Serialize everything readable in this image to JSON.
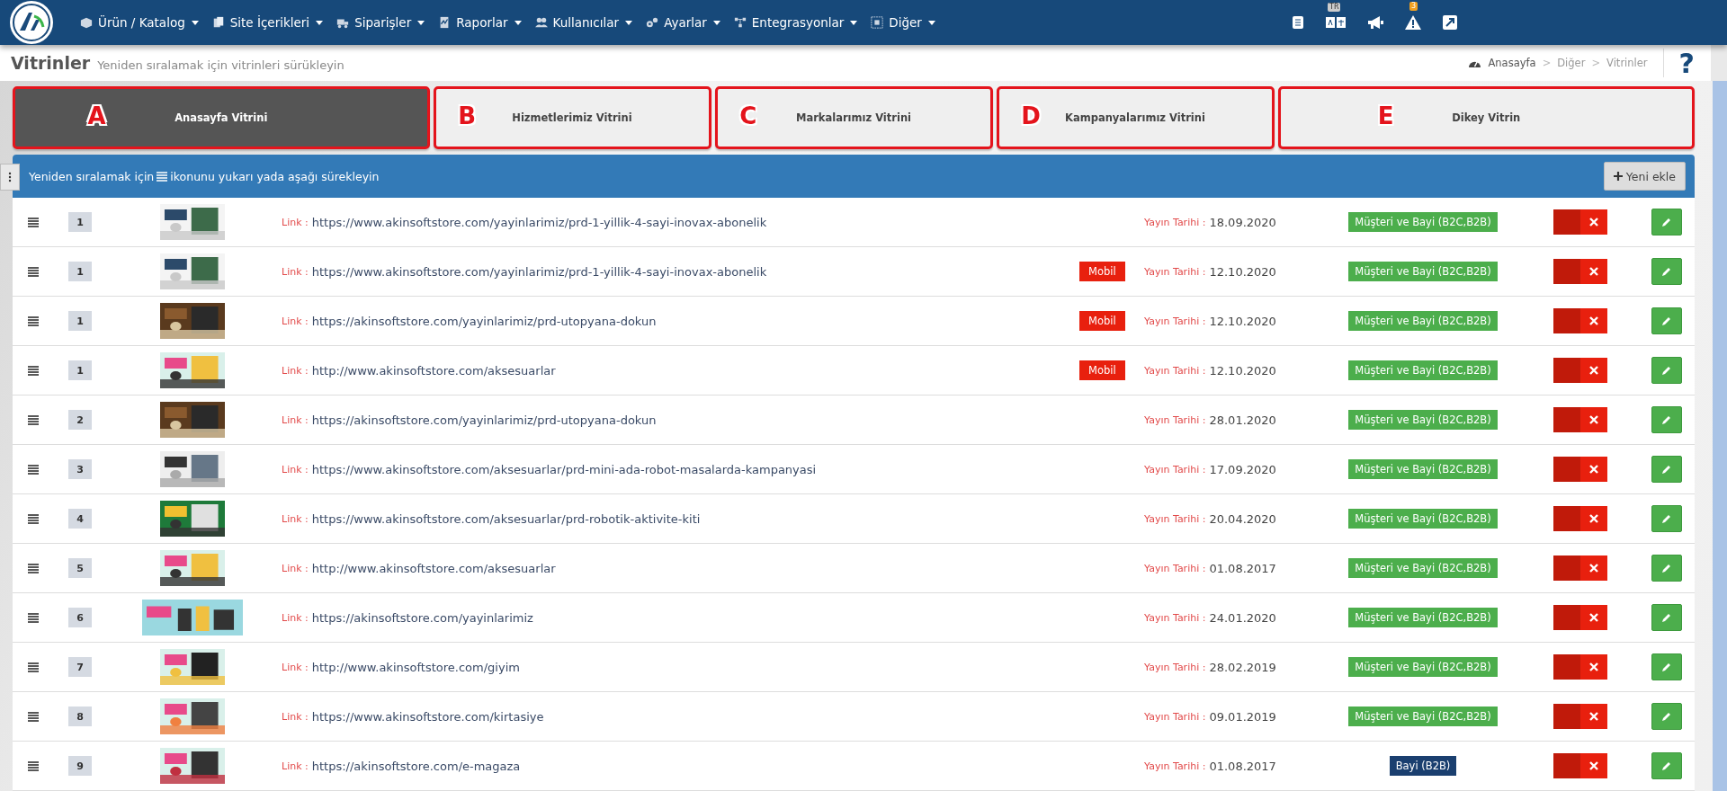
{
  "nav": {
    "menu": [
      {
        "label": "Ürün / Katalog"
      },
      {
        "label": "Site İçerikleri"
      },
      {
        "label": "Siparişler"
      },
      {
        "label": "Raporlar"
      },
      {
        "label": "Kullanıcılar"
      },
      {
        "label": "Ayarlar"
      },
      {
        "label": "Entegrasyonlar"
      },
      {
        "label": "Diğer"
      }
    ],
    "language_badge": "TR",
    "alert_count": "3"
  },
  "page": {
    "title": "Vitrinler",
    "subtitle": "Yeniden sıralamak için vitrinleri sürükleyin",
    "breadcrumb": [
      "Anasayfa",
      "Diğer",
      "Vitrinler"
    ],
    "breadcrumb_separator": ">",
    "help": "?"
  },
  "tabs": [
    {
      "marker": "A",
      "label": "Anasayfa Vitrini",
      "selected": true
    },
    {
      "marker": "B",
      "label": "Hizmetlerimiz Vitrini",
      "selected": false
    },
    {
      "marker": "C",
      "label": "Markalarımız Vitrini",
      "selected": false
    },
    {
      "marker": "D",
      "label": "Kampanyalarımız Vitrini",
      "selected": false
    },
    {
      "marker": "E",
      "label": "Dikey Vitrin",
      "selected": false
    }
  ],
  "panel": {
    "hint_before": "Yeniden sıralamak için",
    "hint_after": "ikonunu yukarı yada aşağı sürekleyin",
    "add_button": "Yeni ekle"
  },
  "rows": [
    {
      "order": "1",
      "link_label": "Link :",
      "url": "https://www.akinsoftstore.com/yayinlarimiz/prd-1-yillik-4-sayi-inovax-abonelik",
      "date_label": "Yayın Tarihi :",
      "date": "18.09.2020",
      "audience": "Müşteri ve Bayi (B2C,B2B)",
      "color": "#4cae4c",
      "on": false
    },
    {
      "order": "1",
      "link_label": "Link :",
      "url": "https://www.akinsoftstore.com/yayinlarimiz/prd-1-yillik-4-sayi-inovax-abonelik",
      "badge": "Mobil",
      "date_label": "Yayın Tarihi :",
      "date": "12.10.2020",
      "audience": "Müşteri ve Bayi (B2C,B2B)",
      "color": "#4cae4c",
      "on": false
    },
    {
      "order": "1",
      "link_label": "Link :",
      "url": "https://akinsoftstore.com/yayinlarimiz/prd-utopyana-dokun",
      "badge": "Mobil",
      "date_label": "Yayın Tarihi :",
      "date": "12.10.2020",
      "audience": "Müşteri ve Bayi (B2C,B2B)",
      "color": "#4cae4c",
      "on": false
    },
    {
      "order": "1",
      "link_label": "Link :",
      "url": "http://www.akinsoftstore.com/aksesuarlar",
      "badge": "Mobil",
      "date_label": "Yayın Tarihi :",
      "date": "12.10.2020",
      "audience": "Müşteri ve Bayi (B2C,B2B)",
      "color": "#4cae4c",
      "on": false
    },
    {
      "order": "2",
      "link_label": "Link :",
      "url": "https://akinsoftstore.com/yayinlarimiz/prd-utopyana-dokun",
      "date_label": "Yayın Tarihi :",
      "date": "28.01.2020",
      "audience": "Müşteri ve Bayi (B2C,B2B)",
      "color": "#4cae4c",
      "on": false
    },
    {
      "order": "3",
      "link_label": "Link :",
      "url": "https://www.akinsoftstore.com/aksesuarlar/prd-mini-ada-robot-masalarda-kampanyasi",
      "date_label": "Yayın Tarihi :",
      "date": "17.09.2020",
      "audience": "Müşteri ve Bayi (B2C,B2B)",
      "color": "#4cae4c",
      "on": false
    },
    {
      "order": "4",
      "link_label": "Link :",
      "url": "https://www.akinsoftstore.com/aksesuarlar/prd-robotik-aktivite-kiti",
      "date_label": "Yayın Tarihi :",
      "date": "20.04.2020",
      "audience": "Müşteri ve Bayi (B2C,B2B)",
      "color": "#4cae4c",
      "on": false
    },
    {
      "order": "5",
      "link_label": "Link :",
      "url": "http://www.akinsoftstore.com/aksesuarlar",
      "date_label": "Yayın Tarihi :",
      "date": "01.08.2017",
      "audience": "Müşteri ve Bayi (B2C,B2B)",
      "color": "#4cae4c",
      "on": false
    },
    {
      "order": "6",
      "link_label": "Link :",
      "url": "https://akinsoftstore.com/yayinlarimiz",
      "date_label": "Yayın Tarihi :",
      "date": "24.01.2020",
      "audience": "Müşteri ve Bayi (B2C,B2B)",
      "color": "#4cae4c",
      "on": false
    },
    {
      "order": "7",
      "link_label": "Link :",
      "url": "http://www.akinsoftstore.com/giyim",
      "date_label": "Yayın Tarihi :",
      "date": "28.02.2019",
      "audience": "Müşteri ve Bayi (B2C,B2B)",
      "color": "#4cae4c",
      "on": false
    },
    {
      "order": "8",
      "link_label": "Link :",
      "url": "https://www.akinsoftstore.com/kirtasiye",
      "date_label": "Yayın Tarihi :",
      "date": "09.01.2019",
      "audience": "Müşteri ve Bayi (B2C,B2B)",
      "color": "#4cae4c",
      "on": false
    },
    {
      "order": "9",
      "link_label": "Link :",
      "url": "https://akinsoftstore.com/e-magaza",
      "date_label": "Yayın Tarihi :",
      "date": "01.08.2017",
      "audience": "Bayi (B2B)",
      "color": "#1a3f6f",
      "on": false
    }
  ]
}
